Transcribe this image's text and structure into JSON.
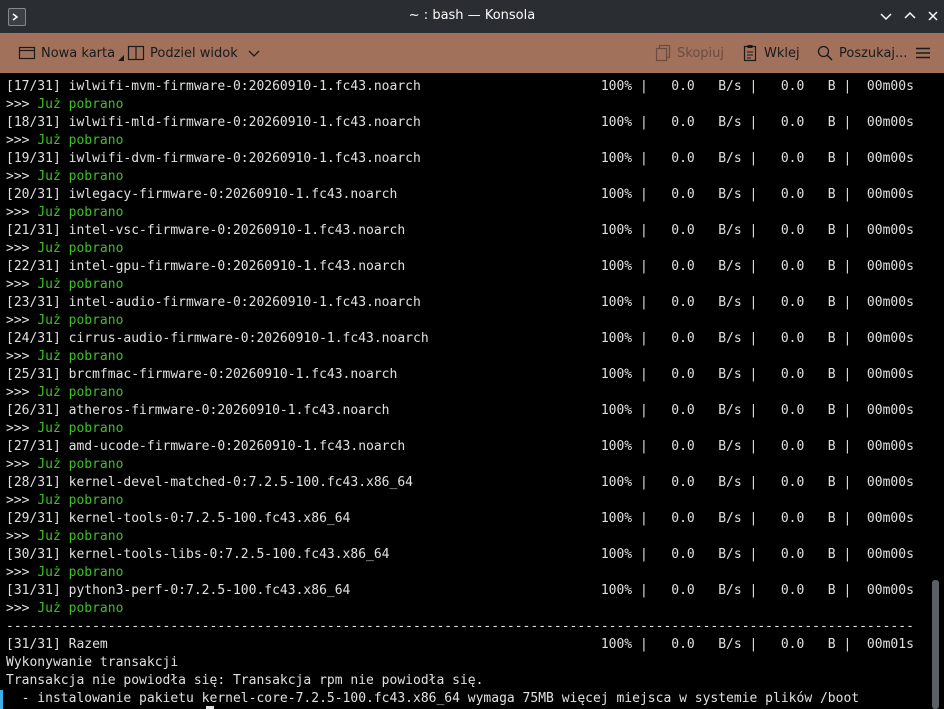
{
  "window": {
    "title": "~ : bash — Konsola"
  },
  "toolbar": {
    "new_tab": "Nowa karta",
    "split_view": "Podziel widok",
    "copy": "Skopiuj",
    "paste": "Wklej",
    "search": "Poszukaj..."
  },
  "terminal": {
    "lines": [
      "[17/31] iwlwifi-mvm-firmware-0:20260910-1.fc43.noarch                       100% |   0.0   B/s |   0.0   B |  00m00s",
      ">>> Już pobrano",
      "[18/31] iwlwifi-mld-firmware-0:20260910-1.fc43.noarch                       100% |   0.0   B/s |   0.0   B |  00m00s",
      ">>> Już pobrano",
      "[19/31] iwlwifi-dvm-firmware-0:20260910-1.fc43.noarch                       100% |   0.0   B/s |   0.0   B |  00m00s",
      ">>> Już pobrano",
      "[20/31] iwlegacy-firmware-0:20260910-1.fc43.noarch                          100% |   0.0   B/s |   0.0   B |  00m00s",
      ">>> Już pobrano",
      "[21/31] intel-vsc-firmware-0:20260910-1.fc43.noarch                         100% |   0.0   B/s |   0.0   B |  00m00s",
      ">>> Już pobrano",
      "[22/31] intel-gpu-firmware-0:20260910-1.fc43.noarch                         100% |   0.0   B/s |   0.0   B |  00m00s",
      ">>> Już pobrano",
      "[23/31] intel-audio-firmware-0:20260910-1.fc43.noarch                       100% |   0.0   B/s |   0.0   B |  00m00s",
      ">>> Już pobrano",
      "[24/31] cirrus-audio-firmware-0:20260910-1.fc43.noarch                      100% |   0.0   B/s |   0.0   B |  00m00s",
      ">>> Już pobrano",
      "[25/31] brcmfmac-firmware-0:20260910-1.fc43.noarch                          100% |   0.0   B/s |   0.0   B |  00m00s",
      ">>> Już pobrano",
      "[26/31] atheros-firmware-0:20260910-1.fc43.noarch                           100% |   0.0   B/s |   0.0   B |  00m00s",
      ">>> Już pobrano",
      "[27/31] amd-ucode-firmware-0:20260910-1.fc43.noarch                         100% |   0.0   B/s |   0.0   B |  00m00s",
      ">>> Już pobrano",
      "[28/31] kernel-devel-matched-0:7.2.5-100.fc43.x86_64                        100% |   0.0   B/s |   0.0   B |  00m00s",
      ">>> Już pobrano",
      "[29/31] kernel-tools-0:7.2.5-100.fc43.x86_64                                100% |   0.0   B/s |   0.0   B |  00m00s",
      ">>> Już pobrano",
      "[30/31] kernel-tools-libs-0:7.2.5-100.fc43.x86_64                           100% |   0.0   B/s |   0.0   B |  00m00s",
      ">>> Już pobrano",
      "[31/31] python3-perf-0:7.2.5-100.fc43.x86_64                                100% |   0.0   B/s |   0.0   B |  00m00s",
      ">>> Już pobrano",
      "--------------------------------------------------------------------------------------------------------------------",
      "[31/31] Razem                                                               100% |   0.0   B/s |   0.0   B |  00m01s",
      "Wykonywanie transakcji",
      "Transakcja nie powiodła się: Transakcja rpm nie powiodła się.",
      "  - instalowanie pakietu kernel-core-7.2.5-100.fc43.x86_64 wymaga 75MB więcej miejsca w systemie plików /boot"
    ]
  },
  "colors": {
    "toolbar_bg": "#a1715c",
    "titlebar_bg": "#2a2e32",
    "success_text": "#3fbf28"
  }
}
